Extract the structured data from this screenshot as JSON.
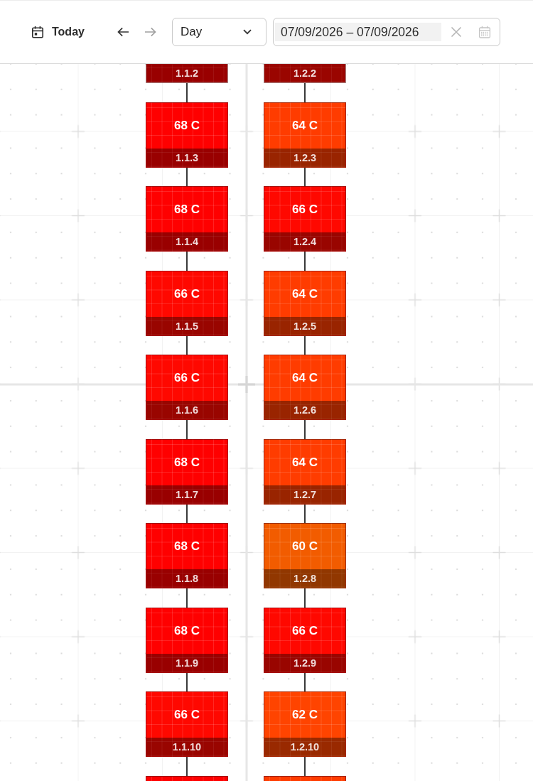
{
  "toolbar": {
    "today_button": {
      "label": "Today"
    },
    "nav_buttons": [
      {
        "kind": "previous",
        "disabled": false
      },
      {
        "kind": "next",
        "disabled": true
      }
    ],
    "view_select": {
      "value": "Day"
    },
    "date_range": {
      "value": "07/09/2026 – 07/09/2026",
      "highlighted": true
    }
  },
  "panel_columns": [
    {
      "panels": [
        {
          "label": "1.1.2",
          "color": "#990000"
        },
        {
          "temperature": "68 C",
          "label": "1.1.3",
          "color": "#ff0000"
        },
        {
          "temperature": "68 C",
          "label": "1.1.4",
          "color": "#ff0000"
        },
        {
          "temperature": "66 C",
          "label": "1.1.5",
          "color": "#ff0800"
        },
        {
          "temperature": "66 C",
          "label": "1.1.6",
          "color": "#ff0800"
        },
        {
          "temperature": "68 C",
          "label": "1.1.7",
          "color": "#ff0000"
        },
        {
          "temperature": "68 C",
          "label": "1.1.8",
          "color": "#ff0000"
        },
        {
          "temperature": "68 C",
          "label": "1.1.9",
          "color": "#ff0000"
        },
        {
          "temperature": "66 C",
          "label": "1.1.10",
          "color": "#ff0800"
        },
        {
          "color": "#ff0000"
        }
      ]
    },
    {
      "panels": [
        {
          "label": "1.2.2",
          "color": "#9a0500"
        },
        {
          "temperature": "64 C",
          "label": "1.2.3",
          "color": "#ff3c00"
        },
        {
          "temperature": "66 C",
          "label": "1.2.4",
          "color": "#ff0800"
        },
        {
          "temperature": "64 C",
          "label": "1.2.5",
          "color": "#ff3c00"
        },
        {
          "temperature": "64 C",
          "label": "1.2.6",
          "color": "#ff3c00"
        },
        {
          "temperature": "64 C",
          "label": "1.2.7",
          "color": "#ff3c00"
        },
        {
          "temperature": "60 C",
          "label": "1.2.8",
          "color": "#f25c00"
        },
        {
          "temperature": "66 C",
          "label": "1.2.9",
          "color": "#ff0800"
        },
        {
          "temperature": "62 C",
          "label": "1.2.10",
          "color": "#ff4400"
        },
        {
          "color": "#ff3c00"
        }
      ]
    }
  ]
}
